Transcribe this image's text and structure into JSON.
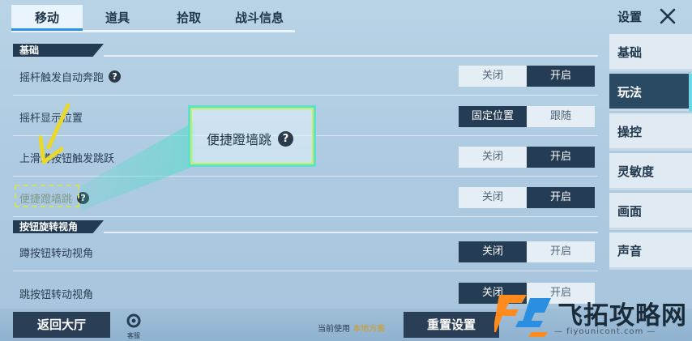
{
  "tabs": [
    {
      "label": "移动",
      "active": true
    },
    {
      "label": "道具",
      "active": false
    },
    {
      "label": "拾取",
      "active": false
    },
    {
      "label": "战斗信息",
      "active": false
    }
  ],
  "header": {
    "title": "设置",
    "close_icon": "close-icon"
  },
  "sections": [
    {
      "title": "基础"
    },
    {
      "title": "按钮旋转视角"
    }
  ],
  "rows": [
    {
      "label": "摇杆触发自动奔跑",
      "help": "?",
      "options": [
        "关闭",
        "开启"
      ],
      "selected": 1
    },
    {
      "label": "摇杆显示位置",
      "options": [
        "固定位置",
        "跟随"
      ],
      "selected": 0
    },
    {
      "label": "上滑蹲按钮触发跳跃",
      "options": [
        "关闭",
        "开启"
      ],
      "selected": 1
    },
    {
      "label": "便捷蹬墙跳",
      "help": "?",
      "options": [
        "关闭",
        "开启"
      ],
      "selected": 1
    },
    {
      "label": "蹲按钮转动视角",
      "options": [
        "关闭",
        "开启"
      ],
      "selected": 0
    },
    {
      "label": "跳按钮转动视角",
      "options": [
        "关闭",
        "开启"
      ],
      "selected": 0
    }
  ],
  "sidebar": {
    "items": [
      {
        "label": "基础",
        "active": false
      },
      {
        "label": "玩法",
        "active": true
      },
      {
        "label": "操控",
        "active": false
      },
      {
        "label": "灵敏度",
        "active": false
      },
      {
        "label": "画面",
        "active": false
      },
      {
        "label": "声音",
        "active": false
      }
    ]
  },
  "highlight": {
    "label": "便捷蹬墙跳",
    "help": "?"
  },
  "footer": {
    "back_label": "返回大厅",
    "cs_label": "客服",
    "scheme_prefix": "当前使用",
    "scheme_name": "本地方案",
    "reset_label": "重置设置"
  },
  "watermark": {
    "text": "飞拓攻略网",
    "url": "— fiyounicont.com —"
  },
  "colors": {
    "accent": "#2e8fe0",
    "dark": "#243c54",
    "highlight": "#5fe0cf",
    "arrow": "#e8d92a"
  }
}
